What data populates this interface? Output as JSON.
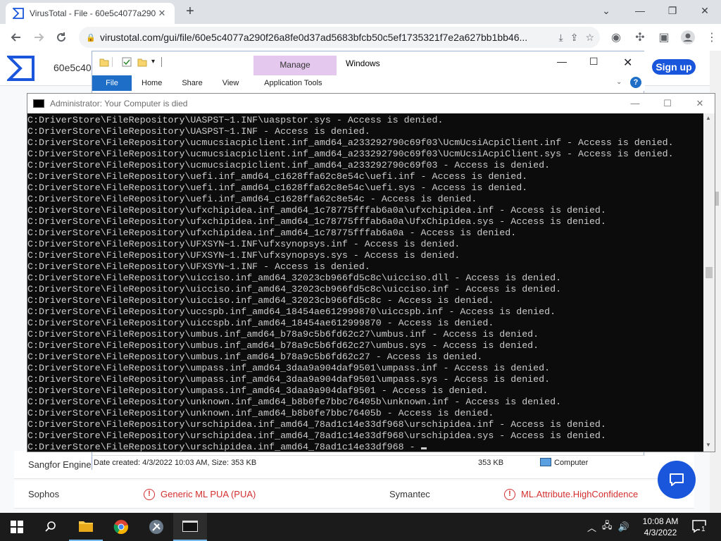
{
  "browser": {
    "tab_title": "VirusTotal - File - 60e5c4077a290",
    "new_tab_symbol": "+",
    "url": "virustotal.com/gui/file/60e5c4077a290f26a8fe0d37ad5683bfcb50c5ef1735321f7e2a627bb1bb46..."
  },
  "vt": {
    "hash_short": "60e5c40",
    "signup_label": "Sign up",
    "rows": [
      {
        "engine": "Sangfor Engine Zero",
        "result": "",
        "engine2": "",
        "result2": ""
      },
      {
        "engine": "Sophos",
        "result": "Generic ML PUA (PUA)",
        "engine2": "Symantec",
        "result2": "ML.Attribute.HighConfidence"
      }
    ]
  },
  "explorer": {
    "manage_label": "Manage",
    "window_title": "Windows",
    "ribbon": {
      "file": "File",
      "home": "Home",
      "share": "Share",
      "view": "View",
      "app_tools": "Application Tools"
    },
    "status": {
      "info": "Date created: 4/3/2022 10:03 AM, Size: 353 KB",
      "size": "353 KB",
      "location": "Computer"
    }
  },
  "cmd": {
    "title": "Administrator:  Your Computer is died",
    "lines": [
      "C:DriverStore\\FileRepository\\UASPST~1.INF\\uaspstor.sys - Access is denied.",
      "C:DriverStore\\FileRepository\\UASPST~1.INF - Access is denied.",
      "C:DriverStore\\FileRepository\\ucmucsiacpiclient.inf_amd64_a233292790c69f03\\UcmUcsiAcpiClient.inf - Access is denied.",
      "C:DriverStore\\FileRepository\\ucmucsiacpiclient.inf_amd64_a233292790c69f03\\UcmUcsiAcpiClient.sys - Access is denied.",
      "C:DriverStore\\FileRepository\\ucmucsiacpiclient.inf_amd64_a233292790c69f03 - Access is denied.",
      "C:DriverStore\\FileRepository\\uefi.inf_amd64_c1628ffa62c8e54c\\uefi.inf - Access is denied.",
      "C:DriverStore\\FileRepository\\uefi.inf_amd64_c1628ffa62c8e54c\\uefi.sys - Access is denied.",
      "C:DriverStore\\FileRepository\\uefi.inf_amd64_c1628ffa62c8e54c - Access is denied.",
      "C:DriverStore\\FileRepository\\ufxchipidea.inf_amd64_1c78775fffab6a0a\\ufxchipidea.inf - Access is denied.",
      "C:DriverStore\\FileRepository\\ufxchipidea.inf_amd64_1c78775fffab6a0a\\UfxChipidea.sys - Access is denied.",
      "C:DriverStore\\FileRepository\\ufxchipidea.inf_amd64_1c78775fffab6a0a - Access is denied.",
      "C:DriverStore\\FileRepository\\UFXSYN~1.INF\\ufxsynopsys.inf - Access is denied.",
      "C:DriverStore\\FileRepository\\UFXSYN~1.INF\\ufxsynopsys.sys - Access is denied.",
      "C:DriverStore\\FileRepository\\UFXSYN~1.INF - Access is denied.",
      "C:DriverStore\\FileRepository\\uicciso.inf_amd64_32023cb966fd5c8c\\uicciso.dll - Access is denied.",
      "C:DriverStore\\FileRepository\\uicciso.inf_amd64_32023cb966fd5c8c\\uicciso.inf - Access is denied.",
      "C:DriverStore\\FileRepository\\uicciso.inf_amd64_32023cb966fd5c8c - Access is denied.",
      "C:DriverStore\\FileRepository\\uccspb.inf_amd64_18454ae612999870\\uiccspb.inf - Access is denied.",
      "C:DriverStore\\FileRepository\\uiccspb.inf_amd64_18454ae612999870 - Access is denied.",
      "C:DriverStore\\FileRepository\\umbus.inf_amd64_b78a9c5b6fd62c27\\umbus.inf - Access is denied.",
      "C:DriverStore\\FileRepository\\umbus.inf_amd64_b78a9c5b6fd62c27\\umbus.sys - Access is denied.",
      "C:DriverStore\\FileRepository\\umbus.inf_amd64_b78a9c5b6fd62c27 - Access is denied.",
      "C:DriverStore\\FileRepository\\umpass.inf_amd64_3daa9a904daf9501\\umpass.inf - Access is denied.",
      "C:DriverStore\\FileRepository\\umpass.inf_amd64_3daa9a904daf9501\\umpass.sys - Access is denied.",
      "C:DriverStore\\FileRepository\\umpass.inf_amd64_3daa9a904daf9501 - Access is denied.",
      "C:DriverStore\\FileRepository\\unknown.inf_amd64_b8b0fe7bbc76405b\\unknown.inf - Access is denied.",
      "C:DriverStore\\FileRepository\\unknown.inf_amd64_b8b0fe7bbc76405b - Access is denied.",
      "C:DriverStore\\FileRepository\\urschipidea.inf_amd64_78ad1c14e33df968\\urschipidea.inf - Access is denied.",
      "C:DriverStore\\FileRepository\\urschipidea.inf_amd64_78ad1c14e33df968\\urschipidea.sys - Access is denied.",
      "C:DriverStore\\FileRepository\\urschipidea.inf_amd64_78ad1c14e33df968 - "
    ]
  },
  "taskbar": {
    "time": "10:08 AM",
    "date": "4/3/2022",
    "notification_count": "1"
  },
  "colors": {
    "vt_blue": "#1a56db",
    "alert_red": "#d32f2f",
    "console_bg": "#0c0c0c",
    "console_text": "#cccccc",
    "explorer_file_tab": "#1e6ec8",
    "manage_tab": "#e5c8ee"
  }
}
